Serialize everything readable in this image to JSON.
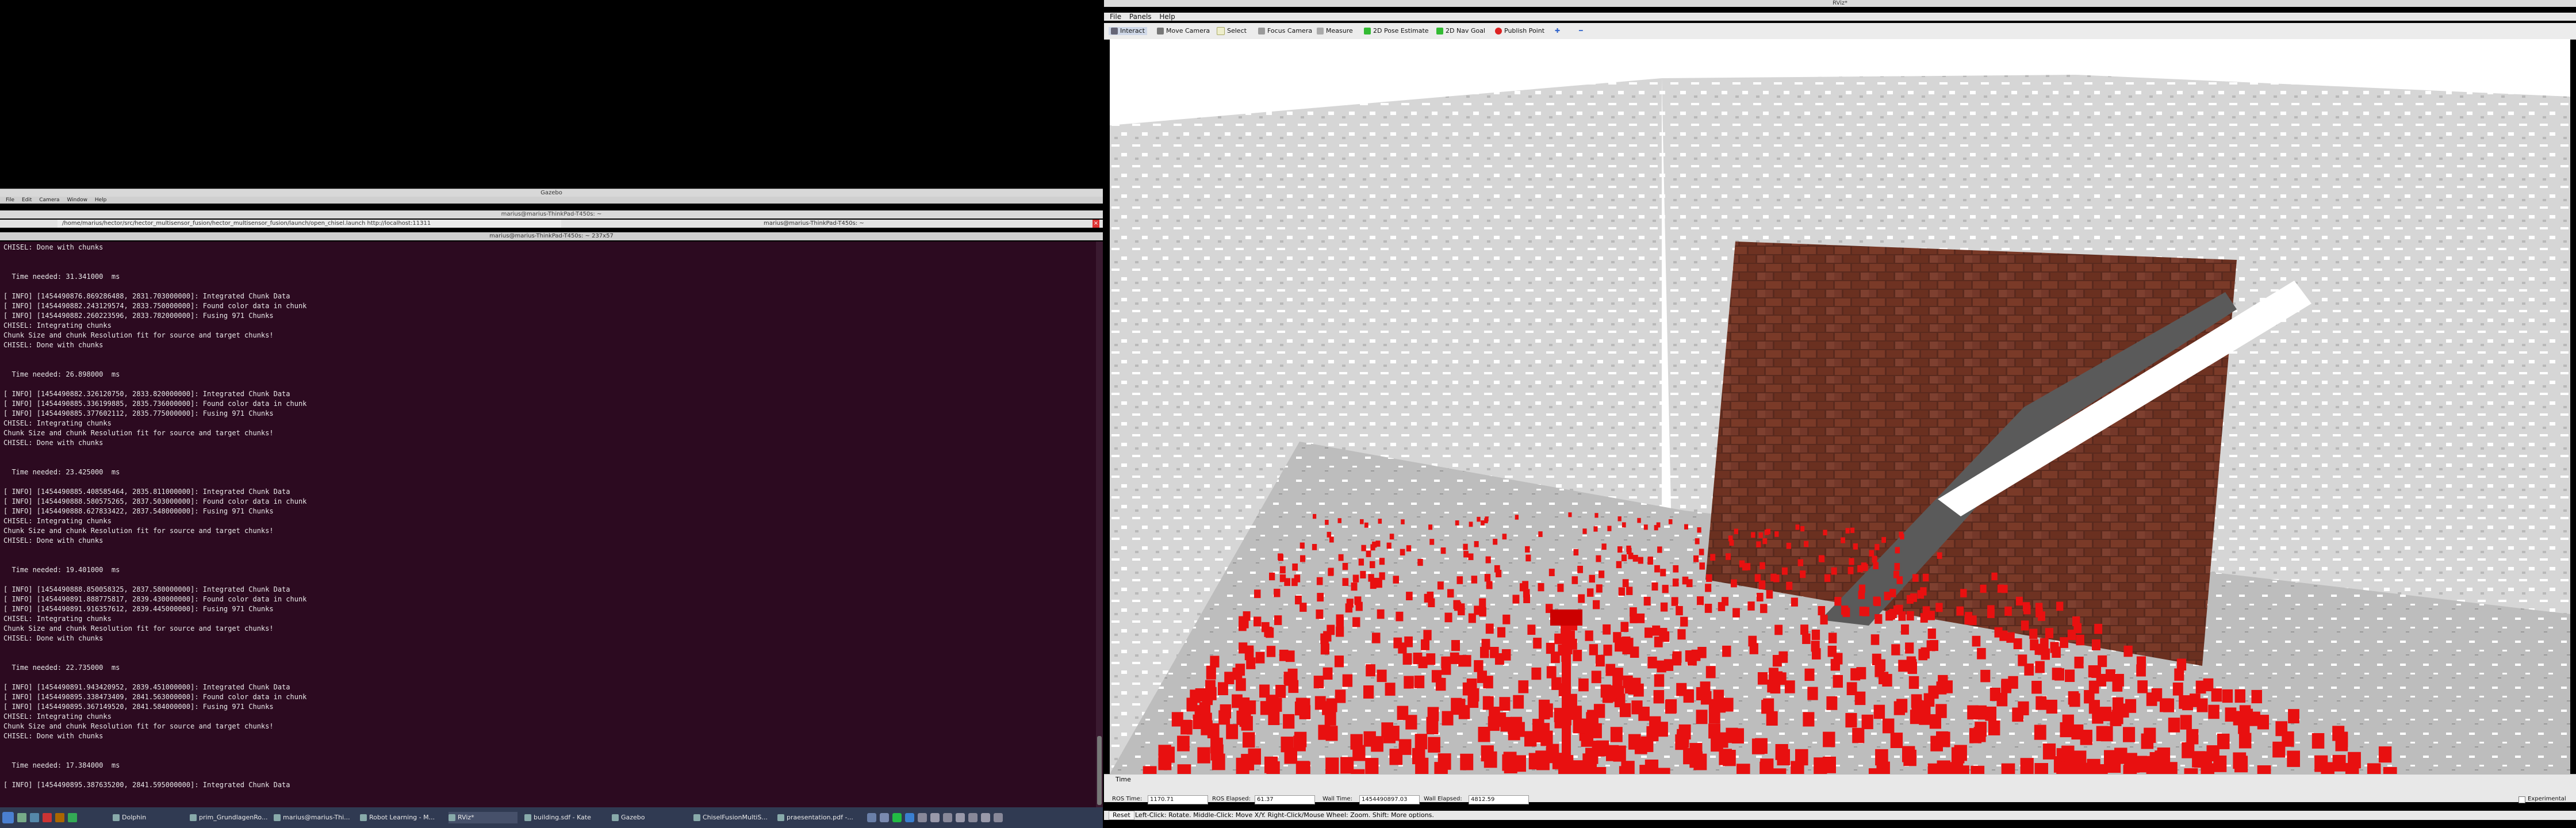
{
  "gazebo": {
    "title": "Gazebo",
    "menu": [
      "File",
      "Edit",
      "Camera",
      "Window",
      "Help"
    ]
  },
  "terminal": {
    "outer_title": "marius@marius-ThinkPad-T450s: ~",
    "tab_left": "/home/marius/hector/src/hector_multisensor_fusion/hector_multisensor_fusion/launch/open_chisel.launch http://localhost:11311",
    "tab_right": "marius@marius-ThinkPad-T450s: ~",
    "inner_title": "marius@marius-ThinkPad-T450s: ~ 237x57",
    "lines": [
      "CHISEL: Done with chunks",
      "",
      "",
      "  Time needed: 31.341000  ms",
      "",
      "[ INFO] [1454490876.869286488, 2831.703000000]: Integrated Chunk Data",
      "[ INFO] [1454490882.243129574, 2833.750000000]: Found color data in chunk",
      "[ INFO] [1454490882.260223596, 2833.782000000]: Fusing 971 Chunks",
      "CHISEL: Integrating chunks",
      "Chunk Size and chunk Resolution fit for source and target chunks!",
      "CHISEL: Done with chunks",
      "",
      "",
      "  Time needed: 26.898000  ms",
      "",
      "[ INFO] [1454490882.326120750, 2833.820000000]: Integrated Chunk Data",
      "[ INFO] [1454490885.336199885, 2835.736000000]: Found color data in chunk",
      "[ INFO] [1454490885.377602112, 2835.775000000]: Fusing 971 Chunks",
      "CHISEL: Integrating chunks",
      "Chunk Size and chunk Resolution fit for source and target chunks!",
      "CHISEL: Done with chunks",
      "",
      "",
      "  Time needed: 23.425000  ms",
      "",
      "[ INFO] [1454490885.408585464, 2835.811000000]: Integrated Chunk Data",
      "[ INFO] [1454490888.580575265, 2837.503000000]: Found color data in chunk",
      "[ INFO] [1454490888.627833422, 2837.548000000]: Fusing 971 Chunks",
      "CHISEL: Integrating chunks",
      "Chunk Size and chunk Resolution fit for source and target chunks!",
      "CHISEL: Done with chunks",
      "",
      "",
      "  Time needed: 19.401000  ms",
      "",
      "[ INFO] [1454490888.850058325, 2837.580000000]: Integrated Chunk Data",
      "[ INFO] [1454490891.888775817, 2839.430000000]: Found color data in chunk",
      "[ INFO] [1454490891.916357612, 2839.445000000]: Fusing 971 Chunks",
      "CHISEL: Integrating chunks",
      "Chunk Size and chunk Resolution fit for source and target chunks!",
      "CHISEL: Done with chunks",
      "",
      "",
      "  Time needed: 22.735000  ms",
      "",
      "[ INFO] [1454490891.943420952, 2839.451000000]: Integrated Chunk Data",
      "[ INFO] [1454490895.338473409, 2841.563000000]: Found color data in chunk",
      "[ INFO] [1454490895.367149520, 2841.584000000]: Fusing 971 Chunks",
      "CHISEL: Integrating chunks",
      "Chunk Size and chunk Resolution fit for source and target chunks!",
      "CHISEL: Done with chunks",
      "",
      "",
      "  Time needed: 17.384000  ms",
      "",
      "[ INFO] [1454490895.387635200, 2841.595000000]: Integrated Chunk Data"
    ]
  },
  "rviz": {
    "title": "RViz*",
    "menu": [
      "File",
      "Panels",
      "Help"
    ],
    "tools": [
      "Interact",
      "Move Camera",
      "Select",
      "Focus Camera",
      "Measure",
      "2D Pose Estimate",
      "2D Nav Goal",
      "Publish Point"
    ],
    "time_panel": {
      "title": "Time",
      "ros_time_label": "ROS Time:",
      "ros_time_value": "1170.71",
      "ros_elapsed_label": "ROS Elapsed:",
      "ros_elapsed_value": "61.37",
      "wall_time_label": "Wall Time:",
      "wall_time_value": "1454490897.03",
      "wall_elapsed_label": "Wall Elapsed:",
      "wall_elapsed_value": "4812.59",
      "experimental_label": "Experimental"
    },
    "status": {
      "reset_label": "Reset",
      "hint": "Left-Click: Rotate. Middle-Click: Move X/Y. Right-Click/Mouse Wheel: Zoom. Shift: More options."
    }
  },
  "taskbar": {
    "tasks": [
      "Dolphin",
      "prim_GrundlagenRo...",
      "marius@marius-Thi...",
      "Robot Learning - M...",
      "RViz*",
      "building.sdf - Kate",
      "Gazebo",
      "ChiselFusionMultiS...",
      "praesentation.pdf -..."
    ]
  },
  "colors": {
    "terminal_bg": "#2c0a20",
    "voxel_red": "#e81010",
    "taskbar_bg": "#303a52"
  }
}
